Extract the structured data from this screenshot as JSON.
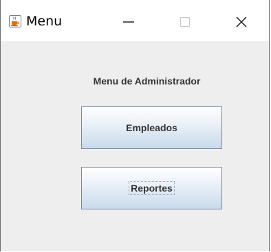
{
  "window": {
    "title": "Menu",
    "icon": "java-cup-icon",
    "controls": {
      "minimize": "minimize-icon",
      "maximize": "maximize-icon",
      "close": "close-icon"
    }
  },
  "main": {
    "heading": "Menu de Administrador",
    "buttons": {
      "empleados": "Empleados",
      "reportes": "Reportes"
    }
  }
}
